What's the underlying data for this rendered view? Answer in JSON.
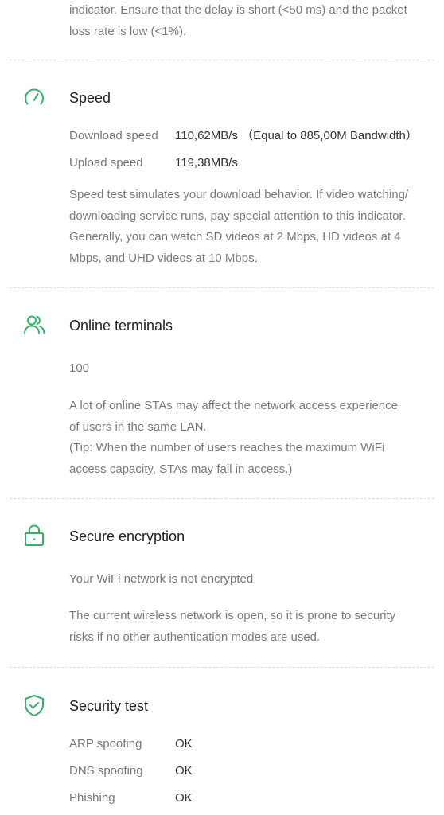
{
  "accent_color": "#2fb36a",
  "network_delay": {
    "description_lines": [
      "indicator. Ensure that the delay is short (<50 ms) and the packet",
      "loss rate is low (<1%)."
    ]
  },
  "speed": {
    "icon": "speedometer-icon",
    "title": "Speed",
    "download_label": "Download speed",
    "download_value": "110,62MB/s （Equal to 885,00M Bandwidth）",
    "upload_label": "Upload speed",
    "upload_value": "119,38MB/s",
    "description_lines": [
      "Speed test simulates your download behavior. If video watching/",
      "downloading service runs, pay special attention to this indicator.",
      "Generally, you can watch SD videos at 2 Mbps, HD videos at 4",
      "Mbps, and UHD videos at 10 Mbps."
    ]
  },
  "online_terminals": {
    "icon": "users-icon",
    "title": "Online terminals",
    "count": "100",
    "description_lines": [
      "A lot of online STAs may affect the network access experience",
      "of users in the same LAN.",
      "(Tip: When the number of users reaches the maximum WiFi",
      "access capacity, STAs may fail in access.)"
    ]
  },
  "secure_encryption": {
    "icon": "lock-icon",
    "title": "Secure encryption",
    "status": "Your WiFi network is not encrypted",
    "description_lines": [
      "The current wireless network is open, so it is prone to security",
      "risks if no other authentication modes are used."
    ]
  },
  "security_test": {
    "icon": "shield-check-icon",
    "title": "Security test",
    "rows": [
      {
        "label": "ARP spoofing",
        "value": "OK"
      },
      {
        "label": "DNS spoofing",
        "value": "OK"
      },
      {
        "label": "Phishing",
        "value": "OK"
      }
    ]
  }
}
